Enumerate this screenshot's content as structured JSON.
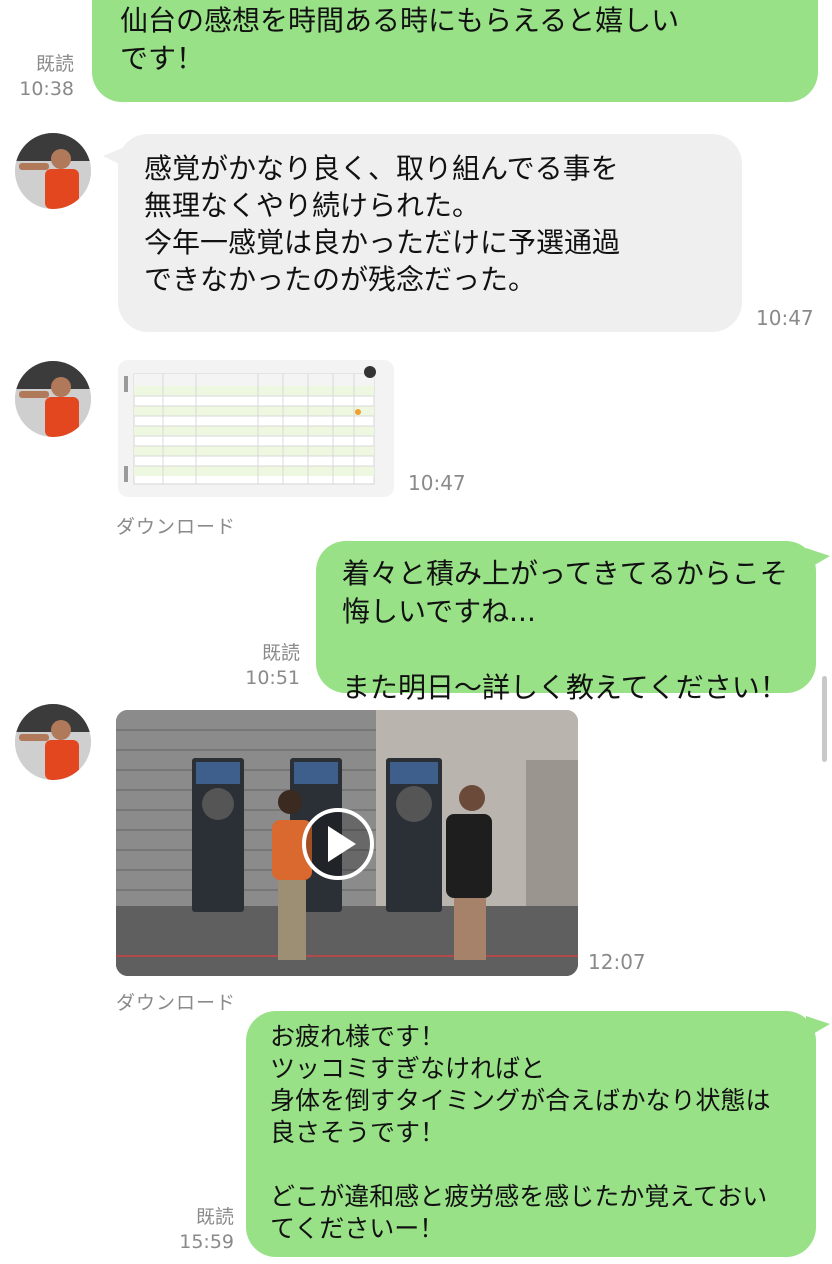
{
  "messages": [
    {
      "id": "m1",
      "direction": "out",
      "text": "仙台の感想を時間ある時にもらえると嬉しい\nです！",
      "read": "既読",
      "time": "10:38"
    },
    {
      "id": "m2",
      "direction": "in",
      "text": "感覚がかなり良く、取り組んでる事を\n無理なくやり続けられた。\n今年一感覚は良かっただけに予選通過\nできなかったのが残念だった。",
      "time": "10:47"
    },
    {
      "id": "m3",
      "direction": "in",
      "type": "image",
      "time": "10:47",
      "download": "ダウンロード"
    },
    {
      "id": "m4",
      "direction": "out",
      "text": "着々と積み上がってきてるからこそ\n悔しいですね...\n\nまた明日〜詳しく教えてください！",
      "read": "既読",
      "time": "10:51"
    },
    {
      "id": "m5",
      "direction": "in",
      "type": "video",
      "time": "12:07",
      "download": "ダウンロード"
    },
    {
      "id": "m6",
      "direction": "out",
      "text": "お疲れ様です！\nツッコミすぎなければと\n身体を倒すタイミングが合えばかなり状態は\n良さそうです！\n\nどこが違和感と疲労感を感じたか覚えておい\nてくださいー！",
      "read": "既読",
      "time": "15:59"
    }
  ],
  "colors": {
    "outgoing_bubble": "#98e187",
    "incoming_bubble": "#efefef",
    "meta_text": "#8a8a8a"
  }
}
